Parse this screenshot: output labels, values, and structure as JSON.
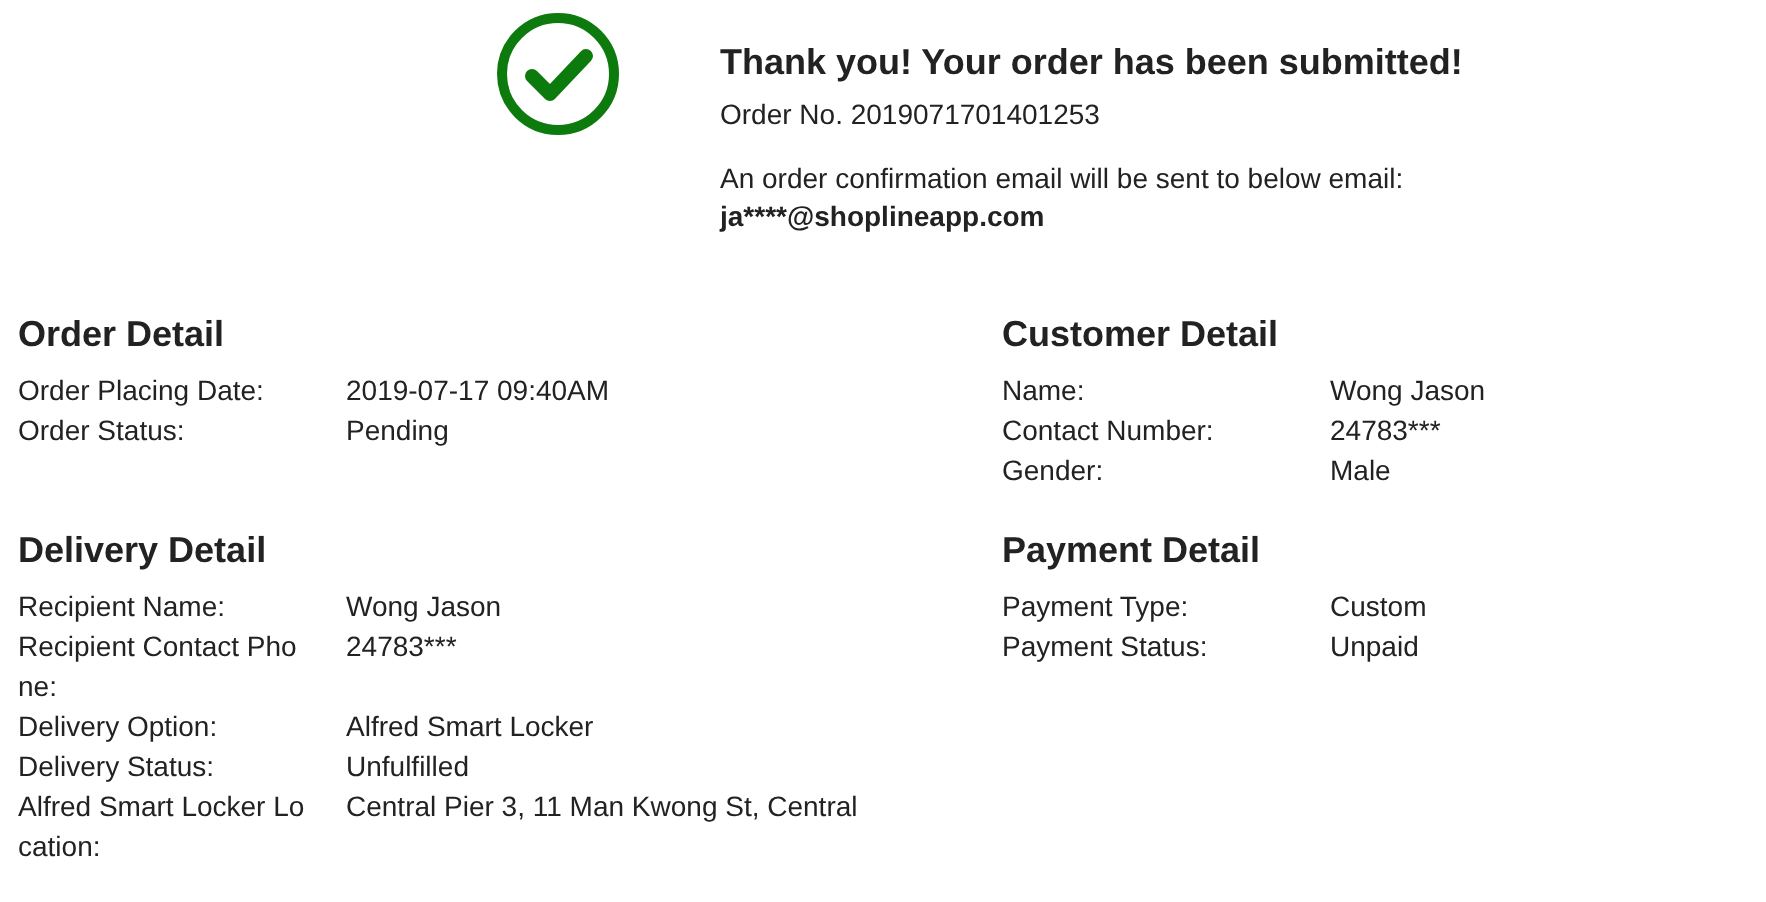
{
  "confirmation": {
    "title": "Thank you! Your order has been submitted!",
    "order_number": "Order No. 2019071701401253",
    "email_note": "An order confirmation email will be sent to below email:",
    "email": "ja****@shoplineapp.com"
  },
  "sections": [
    {
      "title": "Order Detail",
      "rows": [
        {
          "label": "Order Placing Date:",
          "value": "2019-07-17 09:40AM"
        },
        {
          "label": "Order Status:",
          "value": "Pending"
        }
      ]
    },
    {
      "title": "Customer Detail",
      "rows": [
        {
          "label": "Name:",
          "value": "Wong Jason"
        },
        {
          "label": "Contact Number:",
          "value": "24783***"
        },
        {
          "label": "Gender:",
          "value": "Male"
        }
      ]
    },
    {
      "title": "Delivery Detail",
      "rows": [
        {
          "label": "Recipient Name:",
          "value": "Wong Jason"
        },
        {
          "label": "Recipient Contact Phone:",
          "value": "24783***"
        },
        {
          "label": "Delivery Option:",
          "value": "Alfred Smart Locker"
        },
        {
          "label": "Delivery Status:",
          "value": "Unfulfilled"
        },
        {
          "label": "Alfred Smart Locker Location:",
          "value": "Central Pier 3, 11 Man Kwong St, Central"
        }
      ]
    },
    {
      "title": "Payment Detail",
      "rows": [
        {
          "label": "Payment Type:",
          "value": "Custom"
        },
        {
          "label": "Payment Status:",
          "value": "Unpaid"
        }
      ]
    }
  ]
}
